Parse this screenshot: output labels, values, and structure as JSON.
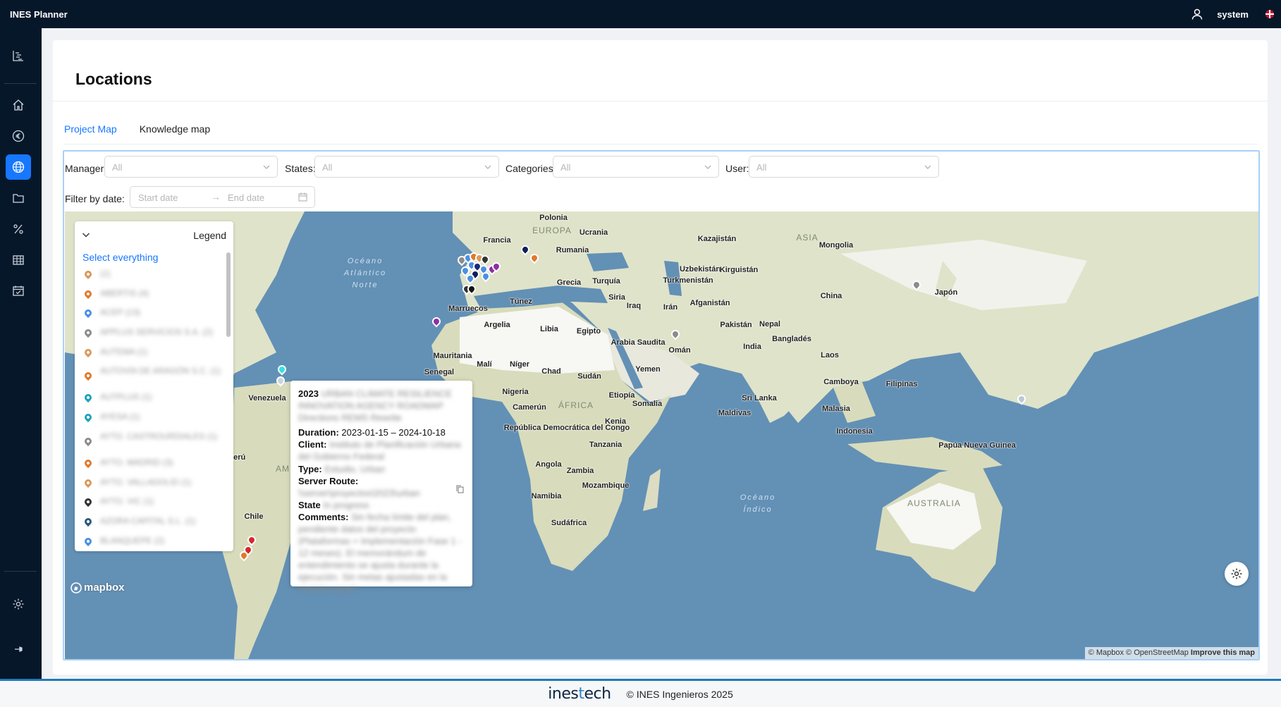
{
  "app": {
    "title": "INES Planner",
    "user": "system"
  },
  "page": {
    "title": "Locations"
  },
  "tabs": [
    {
      "label": "Project Map",
      "active": true
    },
    {
      "label": "Knowledge map",
      "active": false
    }
  ],
  "filters": {
    "manager_label": "Manager:",
    "manager_value": "All",
    "states_label": "States:",
    "states_value": "All",
    "categories_label": "Categories:",
    "categories_value": "All",
    "user_label": "User:",
    "user_value": "All",
    "date_label": "Filter by date:",
    "start_placeholder": "Start date",
    "end_placeholder": "End date"
  },
  "legend": {
    "title": "Legend",
    "select_all": "Select everything",
    "items": [
      {
        "label": "(1)",
        "color": "#d89a5c"
      },
      {
        "label": "ABERTIS (4)",
        "color": "#e07a2c"
      },
      {
        "label": "ACEP (13)",
        "color": "#4a90e2"
      },
      {
        "label": "APPLUS SERVICIOS S.A. (2)",
        "color": "#8c8c8c"
      },
      {
        "label": "AUTEMA (1)",
        "color": "#d89a5c"
      },
      {
        "label": "AUTOVÍA DE ARAGÓN S.C. (1)",
        "color": "#e07a2c"
      },
      {
        "label": "AUTPLUS (1)",
        "color": "#1fa3b8"
      },
      {
        "label": "AYESA (1)",
        "color": "#1fa3b8"
      },
      {
        "label": "AYTO. CASTROURDIALES (1)",
        "color": "#8c8c8c"
      },
      {
        "label": "AYTO. MADRID (3)",
        "color": "#e07a2c"
      },
      {
        "label": "AYTO. VALLADOLID (1)",
        "color": "#d89a5c"
      },
      {
        "label": "AYTO. VIC (1)",
        "color": "#333333"
      },
      {
        "label": "AZORA CAPITAL S.L. (1)",
        "color": "#2c5a7a"
      },
      {
        "label": "BLANQUEPE (2)",
        "color": "#4a90e2"
      }
    ]
  },
  "popup": {
    "title": "2023",
    "title_blur": "URBAN CLIMATE RESILIENCE INNOVATION AGENCY ROADMAP Directions REMS Rewrite",
    "duration_label": "Duration:",
    "duration_value": "2023-01-15 – 2024-10-18",
    "client_label": "Client:",
    "client_blur": "Instituto de Planificación Urbana del Gobierno Federal",
    "type_label": "Type:",
    "type_blur": "Estudio, Urban",
    "route_label": "Server Route:",
    "route_blur": "\\\\server\\proyectos\\2023\\urban",
    "state_label": "State",
    "state_blur": "In progress",
    "comments_label": "Comments:",
    "comments_blur": "Sin fecha límite del plan, pendiente datos del proyecto (Plataformas + Implementación Fase 1 - 12 meses). El memorándum de entendimiento se ajusta durante la ejecución. Sin metas ajustadas en la revisión anual."
  },
  "map": {
    "attribution_mapbox": "© Mapbox",
    "attribution_osm": "© OpenStreetMap",
    "improve": "Improve this map",
    "logo": "mapbox",
    "countries": [
      {
        "name": "Polonia"
      },
      {
        "name": "EUROPA"
      },
      {
        "name": "Ucrania"
      },
      {
        "name": "Kazajistán"
      },
      {
        "name": "Mongolia"
      },
      {
        "name": "ASIA"
      },
      {
        "name": "Francia"
      },
      {
        "name": "Rumania"
      },
      {
        "name": "Uzbekistán"
      },
      {
        "name": "Kirguistán"
      },
      {
        "name": "Turkmenistán"
      },
      {
        "name": "Grecia"
      },
      {
        "name": "Turquía"
      },
      {
        "name": "China"
      },
      {
        "name": "Japón"
      },
      {
        "name": "Siria"
      },
      {
        "name": "Iraq"
      },
      {
        "name": "Irán"
      },
      {
        "name": "Afganistán"
      },
      {
        "name": "Pakistán"
      },
      {
        "name": "Túnez"
      },
      {
        "name": "Marruecos"
      },
      {
        "name": "Argelia"
      },
      {
        "name": "Libia"
      },
      {
        "name": "Egipto"
      },
      {
        "name": "Arabia Saudita"
      },
      {
        "name": "Omán"
      },
      {
        "name": "Nepal"
      },
      {
        "name": "Bangladés"
      },
      {
        "name": "India"
      },
      {
        "name": "Mauritania"
      },
      {
        "name": "Malí"
      },
      {
        "name": "Níger"
      },
      {
        "name": "Chad"
      },
      {
        "name": "Sudán"
      },
      {
        "name": "Yemen"
      },
      {
        "name": "Laos"
      },
      {
        "name": "Senegal"
      },
      {
        "name": "Venezuela"
      },
      {
        "name": "Nigeria"
      },
      {
        "name": "Camboya"
      },
      {
        "name": "Filipinas"
      },
      {
        "name": "Etiopía"
      },
      {
        "name": "ÁFRICA"
      },
      {
        "name": "Camerún"
      },
      {
        "name": "Sri Lanka"
      },
      {
        "name": "República Democrática del Congo"
      },
      {
        "name": "Kenia"
      },
      {
        "name": "Somalia"
      },
      {
        "name": "Maldivas"
      },
      {
        "name": "Malasia"
      },
      {
        "name": "Indonesia"
      },
      {
        "name": "Tanzania"
      },
      {
        "name": "Papúa Nueva Guinea"
      },
      {
        "name": "Angola"
      },
      {
        "name": "Zambia"
      },
      {
        "name": "Mozambique"
      },
      {
        "name": "Namibia"
      },
      {
        "name": "AUSTRALIA"
      },
      {
        "name": "Sudáfrica"
      },
      {
        "name": "Chile"
      },
      {
        "name": "Perú"
      },
      {
        "name": "AM"
      }
    ],
    "oceans": [
      {
        "lines": [
          "Océano",
          "Atlántico",
          "Norte"
        ]
      },
      {
        "lines": [
          "Océano",
          "Índico"
        ]
      }
    ]
  },
  "footer": {
    "logo_a": "ines",
    "logo_b": "t",
    "logo_c": "ech",
    "copyright": "© INES Ingenieros 2025"
  }
}
